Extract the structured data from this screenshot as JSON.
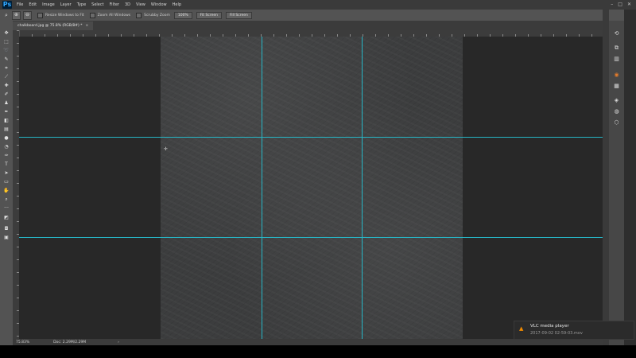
{
  "app": {
    "logo_text": "Ps",
    "menu": [
      "File",
      "Edit",
      "Image",
      "Layer",
      "Type",
      "Select",
      "Filter",
      "3D",
      "View",
      "Window",
      "Help"
    ],
    "window_controls": [
      "–",
      "□",
      "✕"
    ]
  },
  "options_bar": {
    "tool_icon": "zoom-icon",
    "resize_windows_label": "Resize Windows to Fit",
    "zoom_all_windows_label": "Zoom All Windows",
    "scrubby_zoom_label": "Scrubby Zoom",
    "zoom_100_label": "100%",
    "fit_screen_label": "Fit Screen",
    "fill_screen_label": "Fill Screen"
  },
  "document": {
    "tab_title": "chalkboard.jpg @ 75.8% (RGB/8#) *",
    "tab_close": "×"
  },
  "status_bar": {
    "zoom": "75.83%",
    "doc_size": "Doc: 2.29M/2.29M",
    "arrow": "›"
  },
  "notification": {
    "title": "VLC media player",
    "file": "2017-09-02 02-59-03.mov"
  },
  "colors": {
    "guide": "#27b6c6",
    "accent_ps": "#31a8ff",
    "vlc": "#f08a00"
  }
}
